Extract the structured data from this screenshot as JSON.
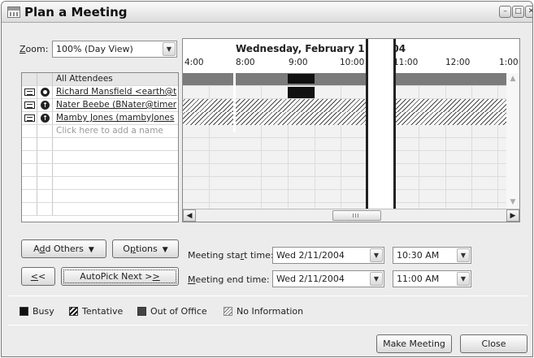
{
  "window": {
    "title": "Plan a Meeting",
    "buttons": {
      "minimize": "–",
      "maximize": "□",
      "close": "✕"
    }
  },
  "zoom": {
    "label_pre": "",
    "label_accel": "Z",
    "label_post": "oom:",
    "value": "100% (Day View)"
  },
  "attendees": {
    "header": "All Attendees",
    "rows": [
      {
        "name": "Richard Mansfield <earth@t",
        "role": "organizer"
      },
      {
        "name": "Nater Beebe (BNater@timer",
        "role": "required"
      },
      {
        "name": "Mamby Jones (mambyJones",
        "role": "required"
      }
    ],
    "add_placeholder": "Click here to add a name"
  },
  "schedule": {
    "date": "Wednesday, February 11, 2004",
    "times": [
      "4:00",
      "8:00",
      "9:00",
      "10:00",
      "11:00",
      "12:00",
      "1:00"
    ]
  },
  "buttons": {
    "add_others": {
      "pre": "A",
      "accel": "d",
      "post": "d Others"
    },
    "options": {
      "pre": "O",
      "accel": "p",
      "post": "tions"
    },
    "prev": {
      "pre": "",
      "accel": "<",
      "post": "<"
    },
    "autopick": {
      "pre": "AutoPick Next >",
      "accel": ">",
      "post": ""
    },
    "make_meeting": "Make Meeting",
    "close": "Close"
  },
  "meeting": {
    "start_label": {
      "pre": "Meeting sta",
      "accel": "r",
      "post": "t time:"
    },
    "end_label": {
      "pre": "",
      "accel": "M",
      "post": "eeting end time:"
    },
    "start_date": "Wed 2/11/2004",
    "start_time": "10:30 AM",
    "end_date": "Wed 2/11/2004",
    "end_time": "11:00 AM"
  },
  "legend": {
    "busy": "Busy",
    "tentative": "Tentative",
    "out_of_office": "Out of Office",
    "no_information": "No Information"
  },
  "colors": {
    "busy": "#111111",
    "free_bar": "#7b7b7b",
    "meeting_outline": "#222222"
  }
}
